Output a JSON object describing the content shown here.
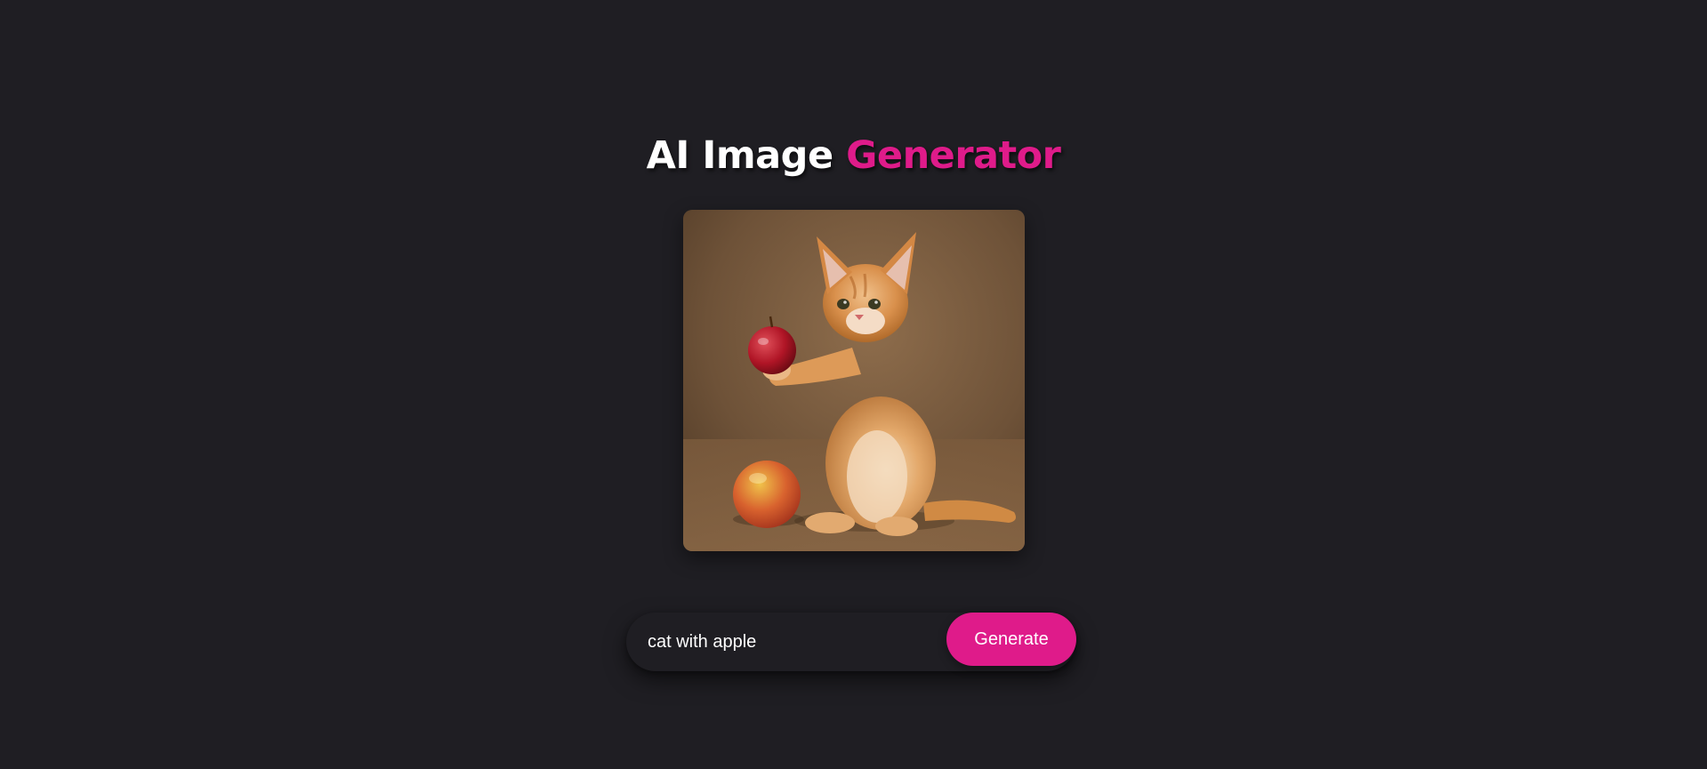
{
  "header": {
    "title_main": "AI Image",
    "title_accent": "Generator"
  },
  "image": {
    "description": "kitten holding apple",
    "alt": "cat with apple"
  },
  "prompt": {
    "value": "cat with apple",
    "placeholder": ""
  },
  "actions": {
    "generate_label": "Generate"
  },
  "colors": {
    "background": "#1f1e23",
    "accent": "#df1b8a",
    "text": "#ffffff"
  }
}
